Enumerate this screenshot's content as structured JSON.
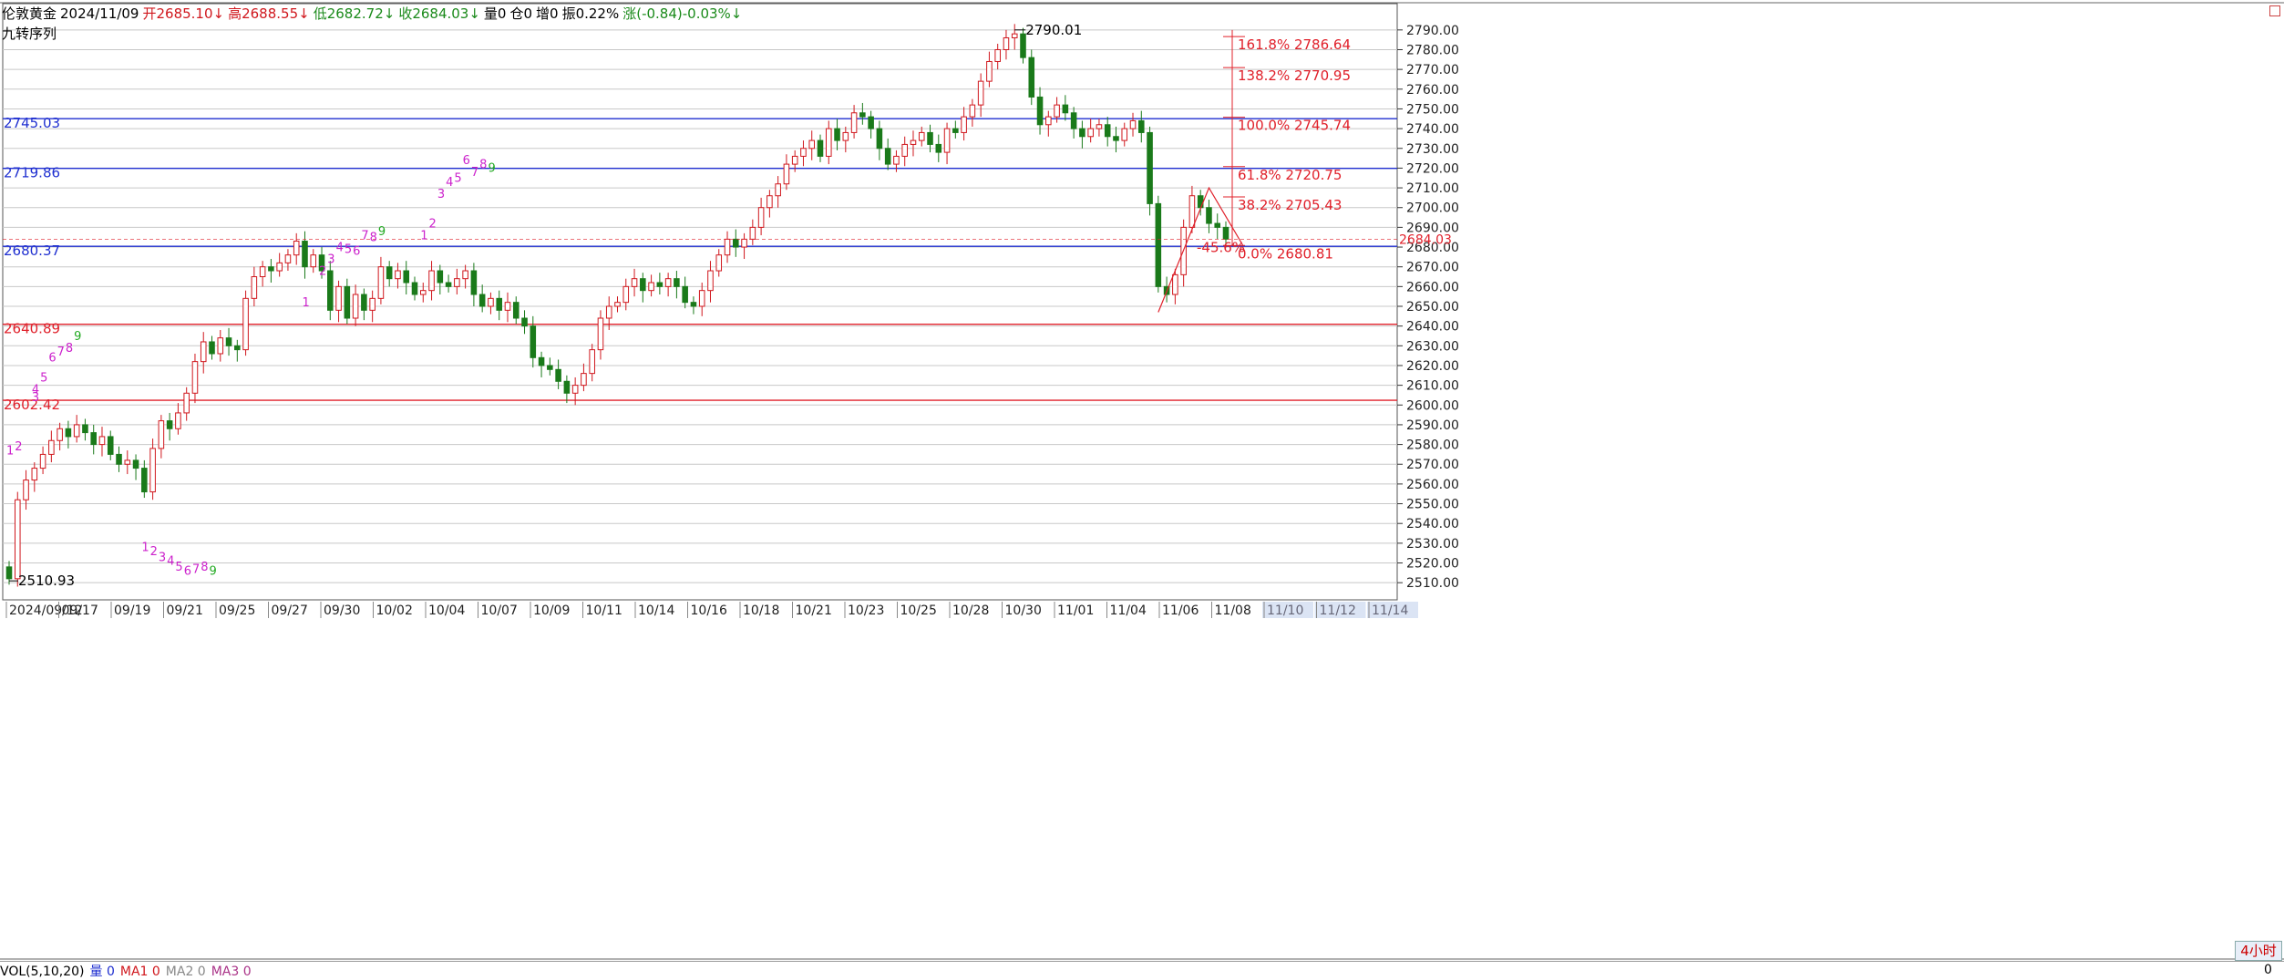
{
  "header": {
    "symbol": "伦敦黄金",
    "date": "2024/11/09",
    "open": "开2685.10↓",
    "high": "高2688.55↓",
    "low": "低2682.72↓",
    "close": "收2684.03↓",
    "volume": "量0",
    "position": "仓0",
    "increase": "增0",
    "amplitude": "振0.22%",
    "change": "涨(-0.84)-0.03%↓"
  },
  "indicator_name": "九转序列",
  "timeframe": "4小时",
  "volume_panel": {
    "label": "VOL(5,10,20)",
    "vol": "量 0",
    "ma1": "MA1 0",
    "ma2": "MA2 0",
    "ma3": "MA3 0",
    "right_value": "0"
  },
  "colors": {
    "up": "#d0171d",
    "down": "#1a7a1a",
    "support": "#1f2fd0",
    "resistance": "#e0202a",
    "seq": "#cc22cc",
    "seq9": "#22aa22",
    "grid": "#c8c8c8"
  },
  "chart_data": {
    "type": "candlestick",
    "ylim": [
      2505,
      2795
    ],
    "y_ticks": [
      2510,
      2520,
      2530,
      2540,
      2550,
      2560,
      2570,
      2580,
      2590,
      2600,
      2610,
      2620,
      2630,
      2640,
      2650,
      2660,
      2670,
      2680,
      2690,
      2700,
      2710,
      2720,
      2730,
      2740,
      2750,
      2760,
      2770,
      2780,
      2790
    ],
    "x_labels": [
      "2024/09/12",
      "09/17",
      "09/19",
      "09/21",
      "09/25",
      "09/27",
      "09/30",
      "10/02",
      "10/04",
      "10/07",
      "10/09",
      "10/11",
      "10/14",
      "10/16",
      "10/18",
      "10/21",
      "10/23",
      "10/25",
      "10/28",
      "10/30",
      "11/01",
      "11/04",
      "11/06",
      "11/08",
      "11/10",
      "11/12",
      "11/14"
    ],
    "hlines": [
      {
        "value": 2745.03,
        "label": "2745.03",
        "kind": "support"
      },
      {
        "value": 2719.86,
        "label": "2719.86",
        "kind": "support"
      },
      {
        "value": 2680.37,
        "label": "2680.37",
        "kind": "support"
      },
      {
        "value": 2640.89,
        "label": "2640.89",
        "kind": "resistance"
      },
      {
        "value": 2602.42,
        "label": "2602.42",
        "kind": "resistance"
      }
    ],
    "fib": [
      {
        "value": 2786.64,
        "label": "161.8% 2786.64"
      },
      {
        "value": 2770.95,
        "label": "138.2% 2770.95"
      },
      {
        "value": 2745.74,
        "label": "100.0% 2745.74"
      },
      {
        "value": 2720.75,
        "label": "61.8% 2720.75"
      },
      {
        "value": 2705.43,
        "label": "38.2% 2705.43"
      },
      {
        "value": 2680.81,
        "label": "0.0% 2680.81"
      }
    ],
    "fib_note": "-45.6%",
    "annotations": [
      {
        "value": 2510.93,
        "label": "2510.93"
      },
      {
        "value": 2790.01,
        "label": "2790.01"
      }
    ],
    "last_price": "2684.03",
    "closes": [
      2512,
      2552,
      2562,
      2568,
      2575,
      2582,
      2588,
      2584,
      2590,
      2586,
      2580,
      2584,
      2575,
      2570,
      2572,
      2568,
      2556,
      2578,
      2592,
      2588,
      2596,
      2606,
      2622,
      2632,
      2626,
      2634,
      2630,
      2628,
      2654,
      2665,
      2670,
      2668,
      2672,
      2676,
      2683,
      2670,
      2676,
      2668,
      2648,
      2660,
      2644,
      2656,
      2648,
      2654,
      2670,
      2664,
      2668,
      2662,
      2656,
      2658,
      2668,
      2662,
      2660,
      2664,
      2668,
      2656,
      2650,
      2654,
      2648,
      2652,
      2644,
      2640,
      2624,
      2620,
      2618,
      2612,
      2606,
      2610,
      2616,
      2628,
      2644,
      2650,
      2652,
      2660,
      2664,
      2658,
      2662,
      2660,
      2664,
      2660,
      2652,
      2650,
      2658,
      2668,
      2676,
      2684,
      2680,
      2684,
      2690,
      2700,
      2706,
      2712,
      2722,
      2726,
      2730,
      2734,
      2726,
      2740,
      2734,
      2738,
      2748,
      2746,
      2740,
      2730,
      2722,
      2726,
      2732,
      2734,
      2738,
      2732,
      2728,
      2740,
      2738,
      2746,
      2752,
      2764,
      2774,
      2780,
      2786,
      2788,
      2776,
      2756,
      2742,
      2746,
      2752,
      2748,
      2740,
      2736,
      2740,
      2742,
      2736,
      2734,
      2740,
      2744,
      2738,
      2702,
      2660,
      2656,
      2666,
      2690,
      2706,
      2700,
      2692,
      2690,
      2684
    ],
    "seq_markers": [
      {
        "i": 0,
        "v": 2575,
        "t": "1"
      },
      {
        "i": 1,
        "v": 2577,
        "t": "2"
      },
      {
        "i": 3,
        "v": 2602,
        "t": "3"
      },
      {
        "i": 3,
        "v": 2606,
        "t": "4"
      },
      {
        "i": 4,
        "v": 2612,
        "t": "5"
      },
      {
        "i": 5,
        "v": 2622,
        "t": "6"
      },
      {
        "i": 6,
        "v": 2625,
        "t": "7"
      },
      {
        "i": 7,
        "v": 2627,
        "t": "8"
      },
      {
        "i": 8,
        "v": 2633,
        "t": "9"
      },
      {
        "i": 16,
        "v": 2526,
        "t": "1"
      },
      {
        "i": 17,
        "v": 2524,
        "t": "2"
      },
      {
        "i": 18,
        "v": 2521,
        "t": "3"
      },
      {
        "i": 19,
        "v": 2519,
        "t": "4"
      },
      {
        "i": 20,
        "v": 2516,
        "t": "5"
      },
      {
        "i": 21,
        "v": 2514,
        "t": "6"
      },
      {
        "i": 22,
        "v": 2515,
        "t": "7"
      },
      {
        "i": 23,
        "v": 2516,
        "t": "8"
      },
      {
        "i": 24,
        "v": 2514,
        "t": "9"
      },
      {
        "i": 35,
        "v": 2650,
        "t": "1"
      },
      {
        "i": 37,
        "v": 2666,
        "t": "2"
      },
      {
        "i": 38,
        "v": 2672,
        "t": "3"
      },
      {
        "i": 39,
        "v": 2678,
        "t": "4"
      },
      {
        "i": 40,
        "v": 2677,
        "t": "5"
      },
      {
        "i": 41,
        "v": 2676,
        "t": "6"
      },
      {
        "i": 42,
        "v": 2684,
        "t": "7"
      },
      {
        "i": 43,
        "v": 2683,
        "t": "8"
      },
      {
        "i": 44,
        "v": 2686,
        "t": "9"
      },
      {
        "i": 49,
        "v": 2684,
        "t": "1"
      },
      {
        "i": 50,
        "v": 2690,
        "t": "2"
      },
      {
        "i": 51,
        "v": 2705,
        "t": "3"
      },
      {
        "i": 52,
        "v": 2711,
        "t": "4"
      },
      {
        "i": 53,
        "v": 2713,
        "t": "5"
      },
      {
        "i": 54,
        "v": 2722,
        "t": "6"
      },
      {
        "i": 55,
        "v": 2716,
        "t": "7"
      },
      {
        "i": 56,
        "v": 2720,
        "t": "8"
      },
      {
        "i": 57,
        "v": 2718,
        "t": "9"
      }
    ]
  }
}
